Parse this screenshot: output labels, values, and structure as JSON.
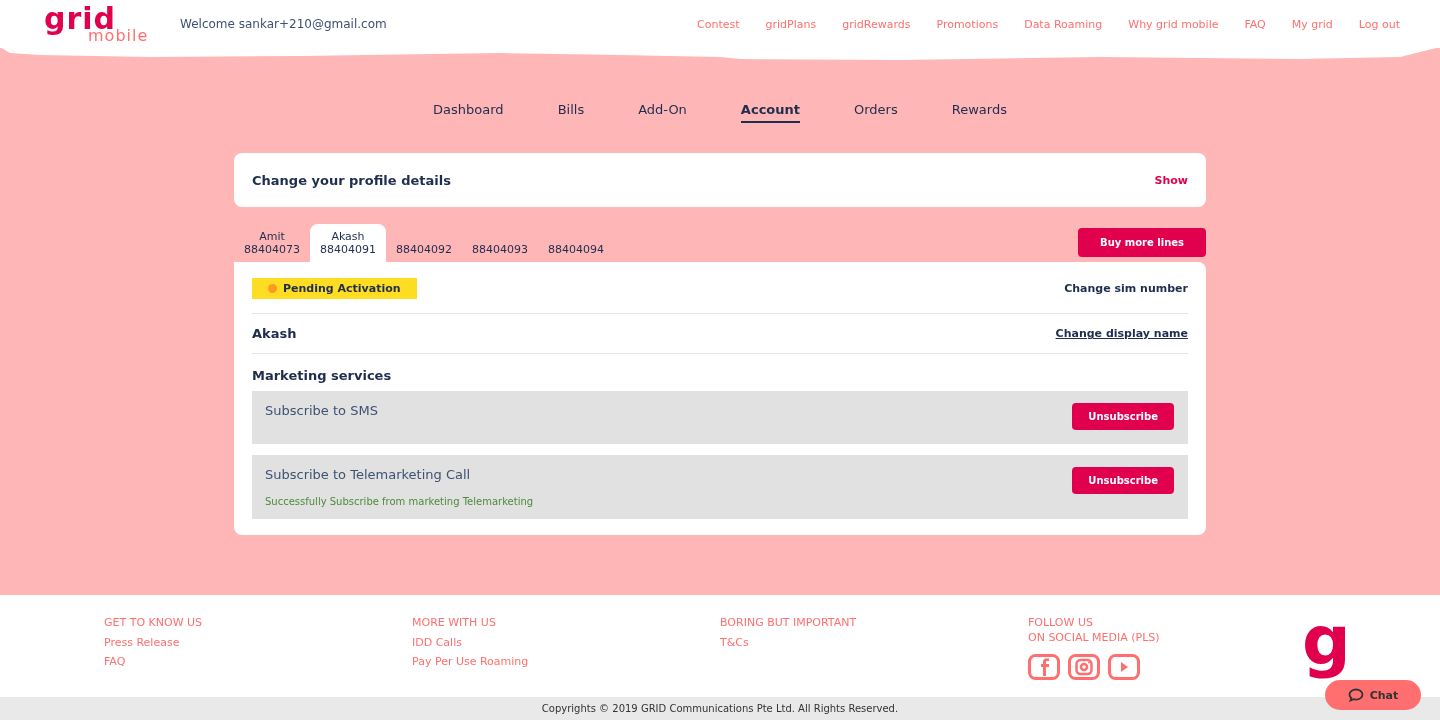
{
  "header": {
    "logo_top": "grid",
    "logo_bottom": "mobile",
    "welcome": "Welcome sankar+210@gmail.com",
    "nav": [
      "Contest",
      "gridPlans",
      "gridRewards",
      "Promotions",
      "Data Roaming",
      "Why grid mobile",
      "FAQ",
      "My grid",
      "Log out"
    ]
  },
  "tabs": [
    {
      "label": "Dashboard",
      "selected": false
    },
    {
      "label": "Bills",
      "selected": false
    },
    {
      "label": "Add-On",
      "selected": false
    },
    {
      "label": "Account",
      "selected": true
    },
    {
      "label": "Orders",
      "selected": false
    },
    {
      "label": "Rewards",
      "selected": false
    }
  ],
  "profile": {
    "title": "Change your profile details",
    "action": "Show"
  },
  "lines": [
    {
      "name": "Amit",
      "number": "88404073",
      "selected": false
    },
    {
      "name": "Akash",
      "number": "88404091",
      "selected": true
    },
    {
      "number": "88404092",
      "selected": false
    },
    {
      "number": "88404093",
      "selected": false
    },
    {
      "number": "88404094",
      "selected": false
    }
  ],
  "buy_button": "Buy more lines",
  "line_panel": {
    "status": "Pending Activation",
    "change_sim": "Change sim number",
    "display_name": "Akash",
    "change_name": "Change display name",
    "marketing_title": "Marketing services",
    "services": [
      {
        "label": "Subscribe to SMS",
        "button": "Unsubscribe"
      },
      {
        "label": "Subscribe to Telemarketing Call",
        "button": "Unsubscribe",
        "message": "Successfully Subscribe from marketing Telemarketing"
      }
    ]
  },
  "footer": {
    "columns": [
      {
        "heading": [
          "GET TO KNOW US"
        ],
        "links": [
          "Press Release",
          "FAQ"
        ]
      },
      {
        "heading": [
          "MORE WITH US"
        ],
        "links": [
          "IDD Calls",
          "Pay Per Use Roaming"
        ]
      },
      {
        "heading": [
          "BORING BUT IMPORTANT"
        ],
        "links": [
          "T&Cs"
        ]
      },
      {
        "heading": [
          "FOLLOW US",
          "ON SOCIAL MEDIA (PLS)"
        ],
        "social": [
          {
            "kind": "facebook"
          },
          {
            "kind": "instagram"
          },
          {
            "kind": "youtube"
          }
        ]
      }
    ],
    "logo_mark": "g",
    "copyright": "Copyrights © 2019 GRID Communications Pte Ltd. All Rights Reserved.",
    "chat": "Chat"
  }
}
